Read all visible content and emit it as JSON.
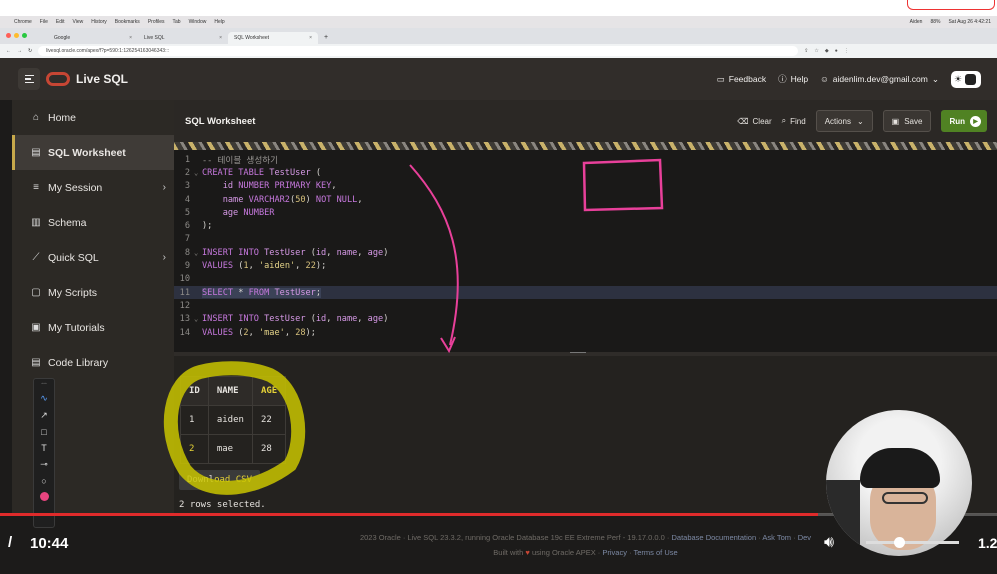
{
  "mac_menu": {
    "items": [
      "Chrome",
      "File",
      "Edit",
      "View",
      "History",
      "Bookmarks",
      "Profiles",
      "Tab",
      "Window",
      "Help"
    ],
    "status": [
      "Aiden",
      "88%",
      "Sat Aug 26 4:42:21"
    ]
  },
  "browser": {
    "tabs": [
      {
        "label": "Google"
      },
      {
        "label": "Live SQL"
      },
      {
        "label": "SQL Worksheet"
      }
    ],
    "url": "livesql.oracle.com/apex/f?p=590:1:126254163046343:::"
  },
  "header": {
    "brand": "Live SQL",
    "feedback": "Feedback",
    "help": "Help",
    "user": "aidenlim.dev@gmail.com"
  },
  "sidebar": {
    "items": [
      {
        "label": "Home",
        "icon": "home-icon"
      },
      {
        "label": "SQL Worksheet",
        "icon": "worksheet-icon"
      },
      {
        "label": "My Session",
        "icon": "list-icon"
      },
      {
        "label": "Schema",
        "icon": "database-icon"
      },
      {
        "label": "Quick SQL",
        "icon": "wand-icon"
      },
      {
        "label": "My Scripts",
        "icon": "script-icon"
      },
      {
        "label": "My Tutorials",
        "icon": "tutorial-icon"
      },
      {
        "label": "Code Library",
        "icon": "library-icon"
      }
    ]
  },
  "worksheet": {
    "title": "SQL Worksheet",
    "clear": "Clear",
    "find": "Find",
    "actions": "Actions",
    "save": "Save",
    "run": "Run"
  },
  "editor": {
    "lines": [
      "-- 테이블 생성하기",
      "CREATE TABLE TestUser (",
      "    id NUMBER PRIMARY KEY,",
      "    name VARCHAR2(50) NOT NULL,",
      "    age NUMBER",
      ");",
      "",
      "INSERT INTO TestUser (id, name, age)",
      "VALUES (1, 'aiden', 22);",
      "",
      "SELECT * FROM TestUser;",
      "",
      "INSERT INTO TestUser (id, name, age)",
      "VALUES (2, 'mae', 28);"
    ]
  },
  "results": {
    "columns": [
      "ID",
      "NAME",
      "AGE"
    ],
    "rows": [
      [
        "1",
        "aiden",
        "22"
      ],
      [
        "2",
        "mae",
        "28"
      ]
    ],
    "download": "Download CSV",
    "status": "2 rows selected."
  },
  "footer": {
    "line1_text": "2023 Oracle · Live SQL 23.3.2, running Oracle Database 19c EE Extreme Perf - 19.17.0.0.0 · ",
    "docs": "Database Documentation",
    "asktom": "Ask Tom",
    "dev": "Dev",
    "built_with": "Built with",
    "using": "using Oracle APEX · ",
    "privacy": "Privacy",
    "terms": "Terms of Use"
  },
  "video": {
    "time": "10:44",
    "speed": "1.2",
    "played_fraction": 0.82,
    "volume_fraction": 0.35
  },
  "colors": {
    "accent_run": "#508223",
    "annotation_pink": "#e8409a",
    "annotation_yellow": "#d4d000",
    "progress_red": "#e02b2b"
  }
}
